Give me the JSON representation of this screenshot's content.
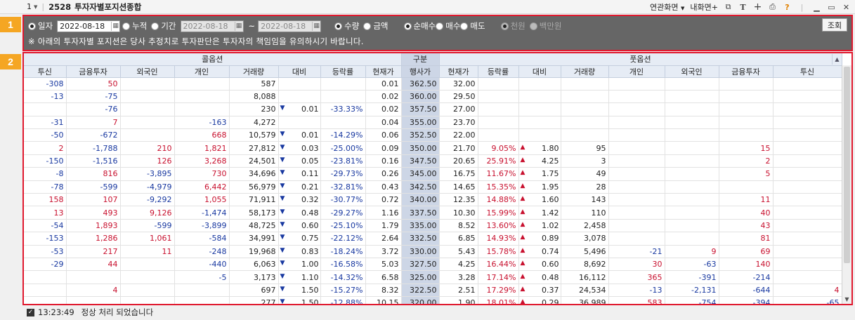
{
  "window": {
    "number": "1",
    "screen_code": "2528",
    "title": "투자자별포지션종합",
    "menu_related": "연관화면",
    "menu_my": "내화면+"
  },
  "markers": [
    "1",
    "2"
  ],
  "controls": {
    "opt_day": "일자",
    "date_single": "2022-08-18",
    "opt_cumulative": "누적",
    "opt_period": "기간",
    "date_from": "2022-08-18",
    "tilde": "~",
    "date_to": "2022-08-18",
    "opt_qty": "수량",
    "opt_amount": "금액",
    "opt_net": "순매수",
    "opt_buy": "매수",
    "opt_sell": "매도",
    "opt_won": "천원",
    "opt_million": "백만원",
    "query_button": "조회",
    "notice": "※ 아래의 투자자별 포지션은 당사 추정치로 투자판단은 투자자의 책임임을 유의하시기 바랍니다."
  },
  "table": {
    "group_call": "콜옵션",
    "group_center": "구분",
    "group_put": "풋옵션",
    "headers": [
      "투신",
      "금융투자",
      "외국인",
      "개인",
      "거래량",
      "대비",
      "등락률",
      "현재가",
      "행사가",
      "현재가",
      "등락률",
      "대비",
      "거래량",
      "개인",
      "외국인",
      "금융투자",
      "투신"
    ],
    "rows": [
      [
        "-308",
        "50",
        "",
        "",
        "587",
        "",
        "",
        "0.01",
        "362.50",
        "32.00",
        "",
        "",
        "",
        "",
        "",
        "",
        ""
      ],
      [
        "-13",
        "-75",
        "",
        "",
        "8,088",
        "",
        "",
        "0.02",
        "360.00",
        "29.50",
        "",
        "",
        "",
        "",
        "",
        "",
        ""
      ],
      [
        "",
        "-76",
        "",
        "",
        "230",
        "0.01",
        "-33.33%",
        "0.02",
        "357.50",
        "27.00",
        "",
        "",
        "",
        "",
        "",
        "",
        ""
      ],
      [
        "-31",
        "7",
        "",
        "-163",
        "4,272",
        "",
        "",
        "0.04",
        "355.00",
        "23.70",
        "",
        "",
        "",
        "",
        "",
        "",
        ""
      ],
      [
        "-50",
        "-672",
        "",
        "668",
        "10,579",
        "0.01",
        "-14.29%",
        "0.06",
        "352.50",
        "22.00",
        "",
        "",
        "",
        "",
        "",
        "",
        ""
      ],
      [
        "2",
        "-1,788",
        "210",
        "1,821",
        "27,812",
        "0.03",
        "-25.00%",
        "0.09",
        "350.00",
        "21.70",
        "9.05%",
        "1.80",
        "95",
        "",
        "",
        "15",
        ""
      ],
      [
        "-150",
        "-1,516",
        "126",
        "3,268",
        "24,501",
        "0.05",
        "-23.81%",
        "0.16",
        "347.50",
        "20.65",
        "25.91%",
        "4.25",
        "3",
        "",
        "",
        "2",
        ""
      ],
      [
        "-8",
        "816",
        "-3,895",
        "730",
        "34,696",
        "0.11",
        "-29.73%",
        "0.26",
        "345.00",
        "16.75",
        "11.67%",
        "1.75",
        "49",
        "",
        "",
        "5",
        ""
      ],
      [
        "-78",
        "-599",
        "-4,979",
        "6,442",
        "56,979",
        "0.21",
        "-32.81%",
        "0.43",
        "342.50",
        "14.65",
        "15.35%",
        "1.95",
        "28",
        "",
        "",
        "",
        ""
      ],
      [
        "158",
        "107",
        "-9,292",
        "1,055",
        "71,911",
        "0.32",
        "-30.77%",
        "0.72",
        "340.00",
        "12.35",
        "14.88%",
        "1.60",
        "143",
        "",
        "",
        "11",
        ""
      ],
      [
        "13",
        "493",
        "9,126",
        "-1,474",
        "58,173",
        "0.48",
        "-29.27%",
        "1.16",
        "337.50",
        "10.30",
        "15.99%",
        "1.42",
        "110",
        "",
        "",
        "40",
        ""
      ],
      [
        "-54",
        "1,893",
        "-599",
        "-3,899",
        "48,725",
        "0.60",
        "-25.10%",
        "1.79",
        "335.00",
        "8.52",
        "13.60%",
        "1.02",
        "2,458",
        "",
        "",
        "43",
        ""
      ],
      [
        "-153",
        "1,286",
        "1,061",
        "-584",
        "34,991",
        "0.75",
        "-22.12%",
        "2.64",
        "332.50",
        "6.85",
        "14.93%",
        "0.89",
        "3,078",
        "",
        "",
        "81",
        ""
      ],
      [
        "-53",
        "217",
        "11",
        "-248",
        "19,968",
        "0.83",
        "-18.24%",
        "3.72",
        "330.00",
        "5.43",
        "15.78%",
        "0.74",
        "5,496",
        "-21",
        "9",
        "69",
        ""
      ],
      [
        "-29",
        "44",
        "",
        "-440",
        "6,063",
        "1.00",
        "-16.58%",
        "5.03",
        "327.50",
        "4.25",
        "16.44%",
        "0.60",
        "8,692",
        "30",
        "-63",
        "140",
        ""
      ],
      [
        "",
        "",
        "",
        "-5",
        "3,173",
        "1.10",
        "-14.32%",
        "6.58",
        "325.00",
        "3.28",
        "17.14%",
        "0.48",
        "16,112",
        "365",
        "-391",
        "-214",
        ""
      ],
      [
        "",
        "4",
        "",
        "",
        "697",
        "1.50",
        "-15.27%",
        "8.32",
        "322.50",
        "2.51",
        "17.29%",
        "0.37",
        "24,534",
        "-13",
        "-2,131",
        "-644",
        "4"
      ],
      [
        "",
        "",
        "",
        "",
        "277",
        "1.50",
        "-12.88%",
        "10.15",
        "320.00",
        "1.90",
        "18.01%",
        "0.29",
        "36,989",
        "583",
        "-754",
        "-394",
        "-65"
      ]
    ]
  },
  "status": {
    "time": "13:23:49",
    "message": "정상 처리 되었습니다"
  },
  "colors": {
    "marker": "#f5a623",
    "panel_border": "#e0182e",
    "positive": "#c8102e",
    "negative": "#1838a0"
  }
}
